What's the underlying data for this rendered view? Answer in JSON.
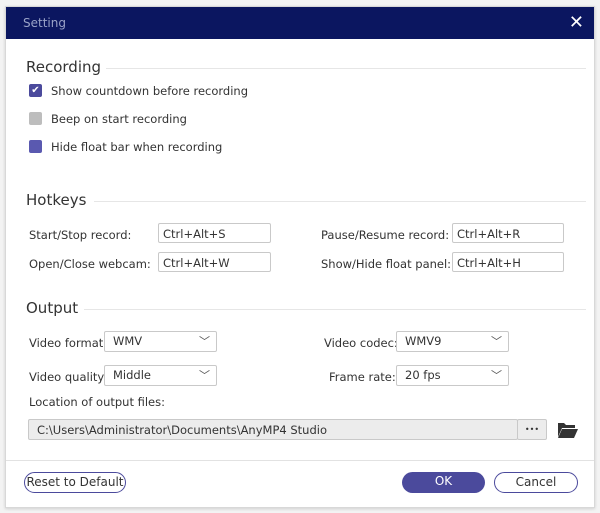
{
  "window": {
    "title": "Setting",
    "close_icon": "close-icon"
  },
  "recording": {
    "heading": "Recording",
    "options": [
      {
        "label": "Show countdown before recording",
        "checked": true
      },
      {
        "label": "Beep on start recording",
        "checked": false
      },
      {
        "label": "Hide float bar when recording",
        "checked": false
      }
    ]
  },
  "hotkeys": {
    "heading": "Hotkeys",
    "start_stop": {
      "label": "Start/Stop record:",
      "value": "Ctrl+Alt+S"
    },
    "pause_resume": {
      "label": "Pause/Resume record:",
      "value": "Ctrl+Alt+R"
    },
    "webcam": {
      "label": "Open/Close webcam:",
      "value": "Ctrl+Alt+W"
    },
    "float_panel": {
      "label": "Show/Hide float panel:",
      "value": "Ctrl+Alt+H"
    }
  },
  "output": {
    "heading": "Output",
    "video_format": {
      "label": "Video format:",
      "value": "WMV"
    },
    "video_codec": {
      "label": "Video codec:",
      "value": "WMV9"
    },
    "video_quality": {
      "label": "Video quality:",
      "value": "Middle"
    },
    "frame_rate": {
      "label": "Frame rate:",
      "value": "20 fps"
    },
    "location_label": "Location of output files:",
    "location_value": "C:\\Users\\Administrator\\Documents\\AnyMP4 Studio",
    "browse_label": "•••"
  },
  "footer": {
    "reset": "Reset to Default",
    "ok": "OK",
    "cancel": "Cancel"
  },
  "colors": {
    "titlebar": "#0b1660",
    "accent": "#4b4a9c"
  }
}
